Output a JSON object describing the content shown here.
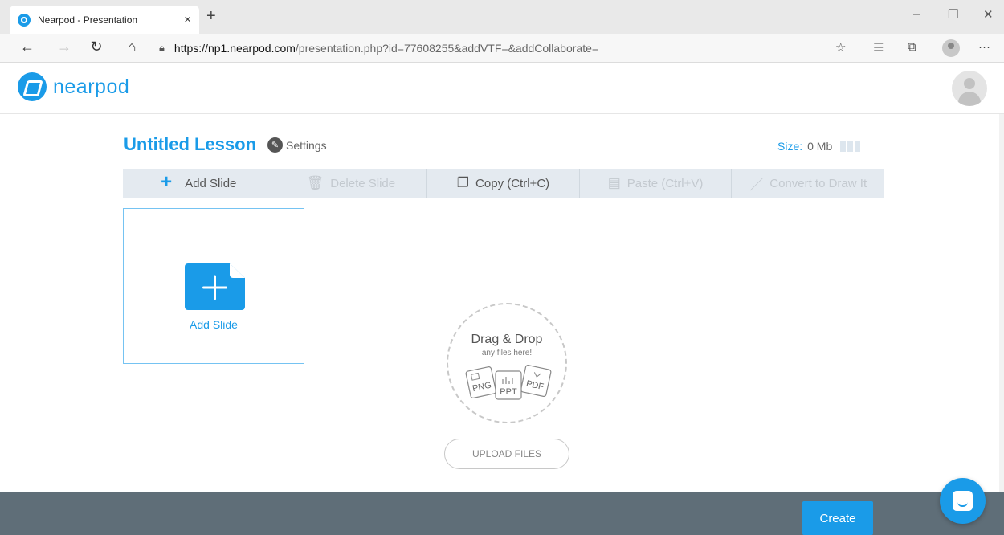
{
  "browser": {
    "tab_title": "Nearpod - Presentation",
    "tab_close": "×",
    "new_tab": "+",
    "url_host": "https://np1.nearpod.com",
    "url_path": "/presentation.php?id=77608255&addVTF=&addCollaborate=",
    "controls": {
      "minimize": "–",
      "restore": "❐",
      "close": "✕"
    },
    "nav": {
      "back": "←",
      "forward": "→",
      "refresh": "↻",
      "home": "⌂"
    },
    "more": "···"
  },
  "app": {
    "logo_text": "nearpod",
    "lesson_title": "Untitled Lesson",
    "settings_label": "Settings",
    "size_label": "Size:",
    "size_value": "0 Mb"
  },
  "toolbar": {
    "add_slide": "Add Slide",
    "delete_slide": "Delete Slide",
    "copy": "Copy (Ctrl+C)",
    "paste": "Paste (Ctrl+V)",
    "convert": "Convert to Draw It"
  },
  "slides": {
    "add_slide_label": "Add Slide"
  },
  "dropzone": {
    "title": "Drag & Drop",
    "subtitle": "any files here!",
    "file_types": [
      "PNG",
      "PPT",
      "PDF"
    ]
  },
  "upload_label": "UPLOAD FILES",
  "footer": {
    "create_label": "Create"
  },
  "colors": {
    "accent": "#1a9be8",
    "footer": "#5f6e78",
    "toolbar": "#e4eaf0"
  }
}
